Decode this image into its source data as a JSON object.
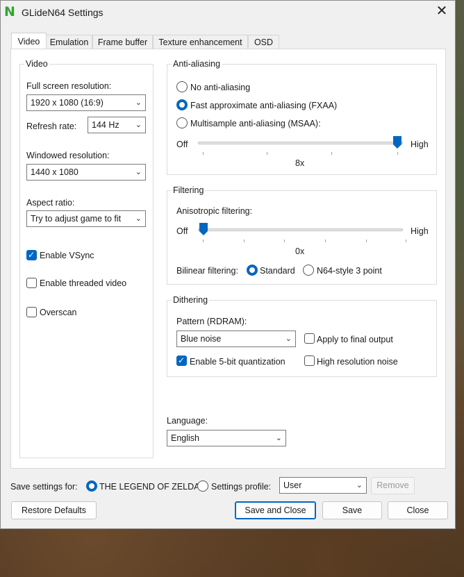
{
  "window": {
    "title": "GLideN64 Settings",
    "logo_letter": "N",
    "close_glyph": "✕"
  },
  "tabs": [
    {
      "label": "Video",
      "active": true
    },
    {
      "label": "Emulation",
      "active": false
    },
    {
      "label": "Frame buffer",
      "active": false
    },
    {
      "label": "Texture enhancement",
      "active": false
    },
    {
      "label": "OSD",
      "active": false
    }
  ],
  "video": {
    "group_title": "Video",
    "fullscreen_label": "Full screen resolution:",
    "fullscreen_value": "1920 x 1080 (16:9)",
    "refresh_label": "Refresh rate:",
    "refresh_value": "144 Hz",
    "windowed_label": "Windowed resolution:",
    "windowed_value": "1440 x 1080",
    "aspect_label": "Aspect ratio:",
    "aspect_value": "Try to adjust game to fit",
    "vsync_label": "Enable VSync",
    "vsync_checked": true,
    "threaded_label": "Enable threaded video",
    "threaded_checked": false,
    "overscan_label": "Overscan",
    "overscan_checked": false
  },
  "antialiasing": {
    "group_title": "Anti-aliasing",
    "options": [
      {
        "label": "No anti-aliasing",
        "selected": false
      },
      {
        "label": "Fast approximate anti-aliasing (FXAA)",
        "selected": true
      },
      {
        "label": "Multisample anti-aliasing (MSAA):",
        "selected": false
      }
    ],
    "slider_min_label": "Off",
    "slider_max_label": "High",
    "slider_level": 1.0,
    "slider_value": "8x"
  },
  "filtering": {
    "group_title": "Filtering",
    "aniso_label": "Anisotropic filtering:",
    "slider_min_label": "Off",
    "slider_max_label": "High",
    "slider_level": 0.0,
    "slider_value": "0x",
    "bilinear_label": "Bilinear filtering:",
    "bilinear_options": [
      {
        "label": "Standard",
        "selected": true
      },
      {
        "label": "N64-style 3 point",
        "selected": false
      }
    ]
  },
  "dithering": {
    "group_title": "Dithering",
    "pattern_label": "Pattern (RDRAM):",
    "pattern_value": "Blue noise",
    "apply_final_label": "Apply to final output",
    "apply_final_checked": false,
    "quantization_label": "Enable 5-bit quantization",
    "quantization_checked": true,
    "hires_noise_label": "High resolution noise",
    "hires_noise_checked": false
  },
  "language": {
    "label": "Language:",
    "value": "English"
  },
  "footer": {
    "save_for_label": "Save settings for:",
    "game_option": "THE LEGEND OF ZELDA",
    "game_selected": true,
    "profile_option": "Settings profile:",
    "profile_selected": false,
    "profile_value": "User",
    "remove_label": "Remove",
    "restore_label": "Restore Defaults",
    "save_close_label": "Save and Close",
    "save_label": "Save",
    "close_label": "Close"
  },
  "colors": {
    "accent": "#0067c0",
    "logo": "#33a22f"
  }
}
